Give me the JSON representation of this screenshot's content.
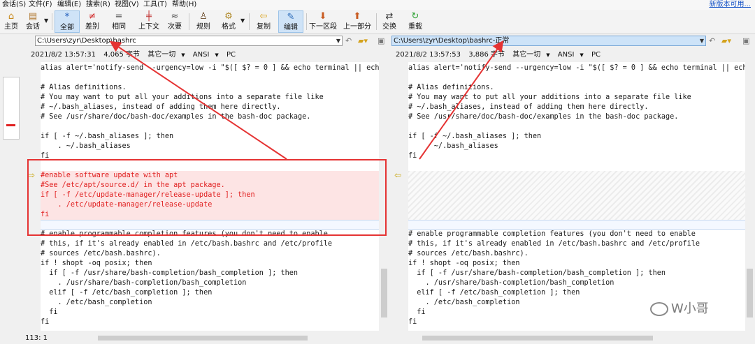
{
  "menu": [
    "会话(S)",
    "文件(F)",
    "编辑(E)",
    "搜索(R)",
    "视图(V)",
    "工具(T)",
    "帮助(H)"
  ],
  "new_version_link": "新版本可用...",
  "toolbar": [
    {
      "label": "主页",
      "icon": "home-icon",
      "glyph": "⌂",
      "color": "#c88a1c"
    },
    {
      "label": "会话",
      "icon": "session-icon",
      "glyph": "▤",
      "color": "#b07830"
    },
    {
      "label": "全部",
      "icon": "asterisk-icon",
      "glyph": "*",
      "color": "#1a58b8",
      "active": true
    },
    {
      "label": "差别",
      "icon": "not-equal-icon",
      "glyph": "≠",
      "color": "#d02020"
    },
    {
      "label": "相同",
      "icon": "equal-icon",
      "glyph": "=",
      "color": "#333333"
    },
    {
      "label": "上下文",
      "icon": "context-icon",
      "glyph": "╪",
      "color": "#c03030"
    },
    {
      "label": "次要",
      "icon": "approx-icon",
      "glyph": "≈",
      "color": "#333333"
    },
    {
      "label": "规则",
      "icon": "rules-person-icon",
      "glyph": "♙",
      "color": "#6a4a2a"
    },
    {
      "label": "格式",
      "icon": "format-gear-icon",
      "glyph": "⚙",
      "color": "#b08a2a"
    },
    {
      "label": "复制",
      "icon": "copy-left-arrow-icon",
      "glyph": "⇦",
      "color": "#d9a21c"
    },
    {
      "label": "编辑",
      "icon": "edit-pencil-icon",
      "glyph": "✎",
      "color": "#2a6ab8",
      "active": true
    },
    {
      "label": "下一区段",
      "icon": "next-section-arrow-icon",
      "glyph": "⬇",
      "color": "#c85a20"
    },
    {
      "label": "上一部分",
      "icon": "prev-section-arrow-icon",
      "glyph": "⬆",
      "color": "#c85a20"
    },
    {
      "label": "交换",
      "icon": "swap-icon",
      "glyph": "⇄",
      "color": "#333333"
    },
    {
      "label": "重载",
      "icon": "reload-icon",
      "glyph": "↻",
      "color": "#2aa030"
    }
  ],
  "left": {
    "path": "C:\\Users\\zyr\\Desktop\\bashrc",
    "info": [
      "2021/8/2 13:57:31",
      "4,065 字节",
      "其它一切",
      "ANSI",
      "PC"
    ],
    "status": "113: 1"
  },
  "right": {
    "path": "C:\\Users\\zyr\\Desktop\\bashrc-正常",
    "info": [
      "2021/8/2 13:57:53",
      "3,886 字节",
      "其它一切",
      "ANSI",
      "PC"
    ]
  },
  "left_lines": [
    "alias alert='notify-send --urgency=low -i \"$([ $? = 0 ] && echo terminal || echo",
    "",
    "# Alias definitions.",
    "# You may want to put all your additions into a separate file like",
    "# ~/.bash_aliases, instead of adding them here directly.",
    "# See /usr/share/doc/bash-doc/examples in the bash-doc package.",
    "",
    "if [ -f ~/.bash_aliases ]; then",
    "    . ~/.bash_aliases",
    "fi",
    "",
    "#enable software update with apt",
    "#See /etc/apt/source.d/ in the apt package.",
    "if [ -f /etc/update-manager/release-update ]; then",
    "    . /etc/update-manager/release-update",
    "fi",
    "",
    "# enable programmable completion features (you don't need to enable",
    "# this, if it's already enabled in /etc/bash.bashrc and /etc/profile",
    "# sources /etc/bash.bashrc).",
    "if ! shopt -oq posix; then",
    "  if [ -f /usr/share/bash-completion/bash_completion ]; then",
    "    . /usr/share/bash-completion/bash_completion",
    "  elif [ -f /etc/bash_completion ]; then",
    "    . /etc/bash_completion",
    "  fi",
    "fi"
  ],
  "right_lines": [
    "alias alert='notify-send --urgency=low -i \"$([ $? = 0 ] && echo terminal || ech",
    "",
    "# Alias definitions.",
    "# You may want to put all your additions into a separate file like",
    "# ~/.bash_aliases, instead of adding them here directly.",
    "# See /usr/share/doc/bash-doc/examples in the bash-doc package.",
    "",
    "if [ -f ~/.bash_aliases ]; then",
    "    . ~/.bash_aliases",
    "fi",
    "",
    "",
    "",
    "",
    "",
    "",
    "",
    "# enable programmable completion features (you don't need to enable",
    "# this, if it's already enabled in /etc/bash.bashrc and /etc/profile",
    "# sources /etc/bash.bashrc).",
    "if ! shopt -oq posix; then",
    "  if [ -f /usr/share/bash-completion/bash_completion ]; then",
    "    . /usr/share/bash-completion/bash_completion",
    "  elif [ -f /etc/bash_completion ]; then",
    "    . /etc/bash_completion",
    "  fi",
    "fi"
  ],
  "watermark": "W小哥",
  "annotation_color": "#e53333"
}
